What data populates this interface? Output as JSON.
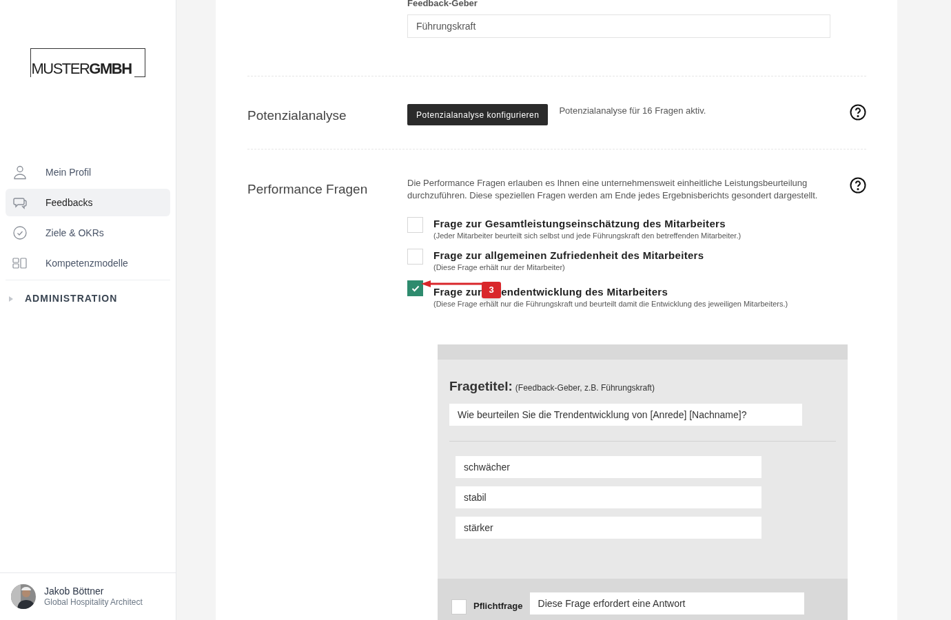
{
  "logo": {
    "light": "MUSTER",
    "bold": "GMBH"
  },
  "sidebar": {
    "items": [
      {
        "label": "Mein Profil",
        "selected": false
      },
      {
        "label": "Feedbacks",
        "selected": true
      },
      {
        "label": "Ziele & OKRs",
        "selected": false
      },
      {
        "label": "Kompetenzmodelle",
        "selected": false
      }
    ],
    "section": {
      "label": "ADMINISTRATION",
      "expanded": false
    }
  },
  "user": {
    "name": "Jakob Böttner",
    "role": "Global Hospitality Architect"
  },
  "feedback_giver": {
    "label": "Feedback-Geber",
    "value": "Führungskraft"
  },
  "potential_analysis": {
    "label": "Potenzialanalyse",
    "button": "Potenzialanalyse konfigurieren",
    "status": "Potenzialanalyse für 16 Fragen aktiv."
  },
  "performance": {
    "label": "Performance Fragen",
    "description": "Die Performance Fragen erlauben es Ihnen eine unternehmensweit einheitliche Leistungsbeurteilung durchzuführen. Diese speziellen Fragen werden am Ende jedes Ergebnisberichts gesondert dargestellt.",
    "questions": [
      {
        "title_parts": [
          "Frage zur Gesamtleistungseinschätzung des Mitarbeiters"
        ],
        "note": "(Jeder Mitarbeiter beurteilt sich selbst und jede Führungskraft den betreffenden Mitarbeiter.)",
        "checked": false
      },
      {
        "title_parts": [
          "Frage zur allgemeinen Zufriedenheit des Mitarbeiters"
        ],
        "note": "(Diese Frage erhält nur der Mitarbeiter)",
        "checked": false
      },
      {
        "title_parts": [
          "Frage zur",
          "endentwicklung des Mitarbeiters"
        ],
        "note": "(Diese Frage erhält nur die Führungskraft und beurteilt damit die Entwicklung des jeweiligen Mitarbeiters.)",
        "checked": true,
        "annotation": "3"
      }
    ]
  },
  "question_editor": {
    "heading": "Fragetitel:",
    "hint": "(Feedback-Geber, z.B. Führungskraft)",
    "value": "Wie beurteilen Sie die Trendentwicklung von [Anrede] [Nachname]?",
    "options": [
      "schwächer",
      "stabil",
      "stärker"
    ],
    "required": {
      "label": "Pflichtfrage",
      "checked": false,
      "value": "Diese Frage erfordert eine Antwort"
    }
  }
}
